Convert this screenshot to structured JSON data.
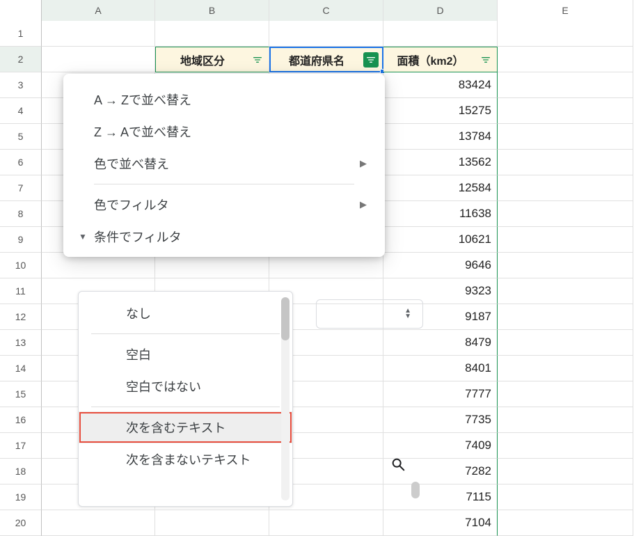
{
  "columns": [
    "A",
    "B",
    "C",
    "D",
    "E"
  ],
  "rows": [
    1,
    2,
    3,
    4,
    5,
    6,
    7,
    8,
    9,
    10,
    11,
    12,
    13,
    14,
    15,
    16,
    17,
    18,
    19,
    20
  ],
  "headers": {
    "B": "地域区分",
    "C": "都道府県名",
    "D": "面積（km2）"
  },
  "data_D": [
    83424,
    15275,
    13784,
    13562,
    12584,
    11638,
    10621,
    9646,
    9323,
    9187,
    8479,
    8401,
    7777,
    7735,
    7409,
    7282,
    7115,
    7104
  ],
  "filter_menu": {
    "sort_az": "A → Zで並べ替え",
    "sort_za": "Z → Aで並べ替え",
    "sort_color": "色で並べ替え",
    "filter_color": "色でフィルタ",
    "filter_condition": "条件でフィルタ"
  },
  "condition_options": {
    "none": "なし",
    "blank": "空白",
    "not_blank": "空白ではない",
    "contains": "次を含むテキスト",
    "not_contains": "次を含まないテキスト"
  }
}
